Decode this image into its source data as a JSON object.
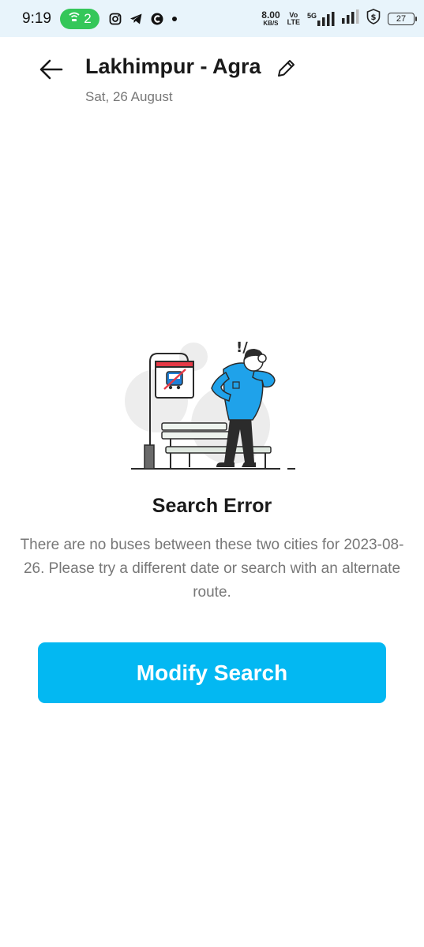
{
  "status_bar": {
    "time": "9:19",
    "hotspot_count": "2",
    "speed_value": "8.00",
    "speed_unit": "KB/S",
    "volte_top": "Vo",
    "volte_bottom": "LTE",
    "network_label": "5G",
    "battery": "27"
  },
  "header": {
    "title": "Lakhimpur - Agra",
    "date": "Sat, 26 August"
  },
  "error": {
    "title": "Search Error",
    "message": "There are no buses between these two cities for 2023-08-26. Please try a different date or search with an alternate route.",
    "illustration_mark": "!/"
  },
  "actions": {
    "modify_label": "Modify Search"
  },
  "colors": {
    "primary": "#03b8f2",
    "status_bar_bg": "#e8f4fb",
    "hotspot_pill": "#34c759",
    "person_shirt": "#1fa2ea",
    "sign_red": "#e63946"
  }
}
